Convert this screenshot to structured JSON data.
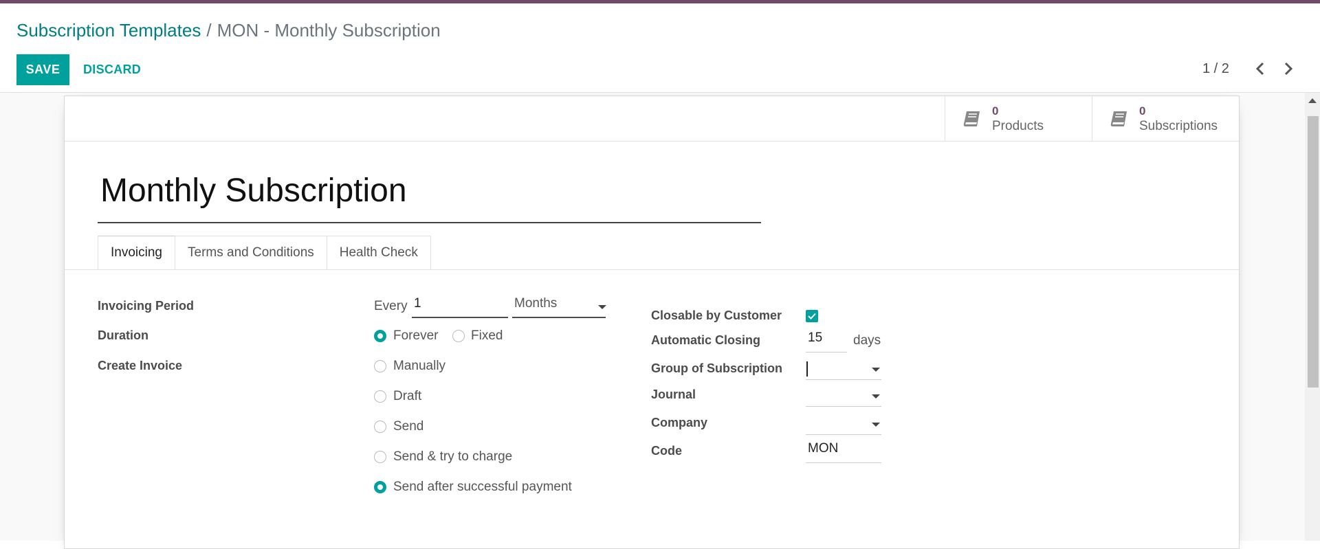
{
  "breadcrumb": {
    "parent": "Subscription Templates",
    "separator": "/",
    "current": "MON - Monthly Subscription"
  },
  "toolbar": {
    "save_label": "SAVE",
    "discard_label": "DISCARD",
    "pager": "1 / 2"
  },
  "stat_buttons": [
    {
      "value": "0",
      "label": "Products",
      "icon": "book-icon"
    },
    {
      "value": "0",
      "label": "Subscriptions",
      "icon": "book-icon"
    }
  ],
  "form": {
    "title": "Monthly Subscription",
    "tabs": [
      "Invoicing",
      "Terms and Conditions",
      "Health Check"
    ],
    "active_tab": "Invoicing",
    "invoicing_period": {
      "label": "Invoicing Period",
      "prefix": "Every",
      "value": "1",
      "unit": "Months"
    },
    "duration": {
      "label": "Duration",
      "options": [
        "Forever",
        "Fixed"
      ],
      "selected": "Forever"
    },
    "create_invoice": {
      "label": "Create Invoice",
      "options": [
        "Manually",
        "Draft",
        "Send",
        "Send & try to charge",
        "Send after successful payment"
      ],
      "selected": "Send after successful payment"
    },
    "closable_by_customer": {
      "label": "Closable by Customer",
      "checked": true
    },
    "automatic_closing": {
      "label": "Automatic Closing",
      "value": "15",
      "unit": "days"
    },
    "group_of_subscription": {
      "label": "Group of Subscription",
      "value": ""
    },
    "journal": {
      "label": "Journal",
      "value": ""
    },
    "company": {
      "label": "Company",
      "value": ""
    },
    "code": {
      "label": "Code",
      "value": "MON"
    }
  },
  "colors": {
    "accent": "#00A09D",
    "brand": "#714B67",
    "link": "#017e84"
  }
}
